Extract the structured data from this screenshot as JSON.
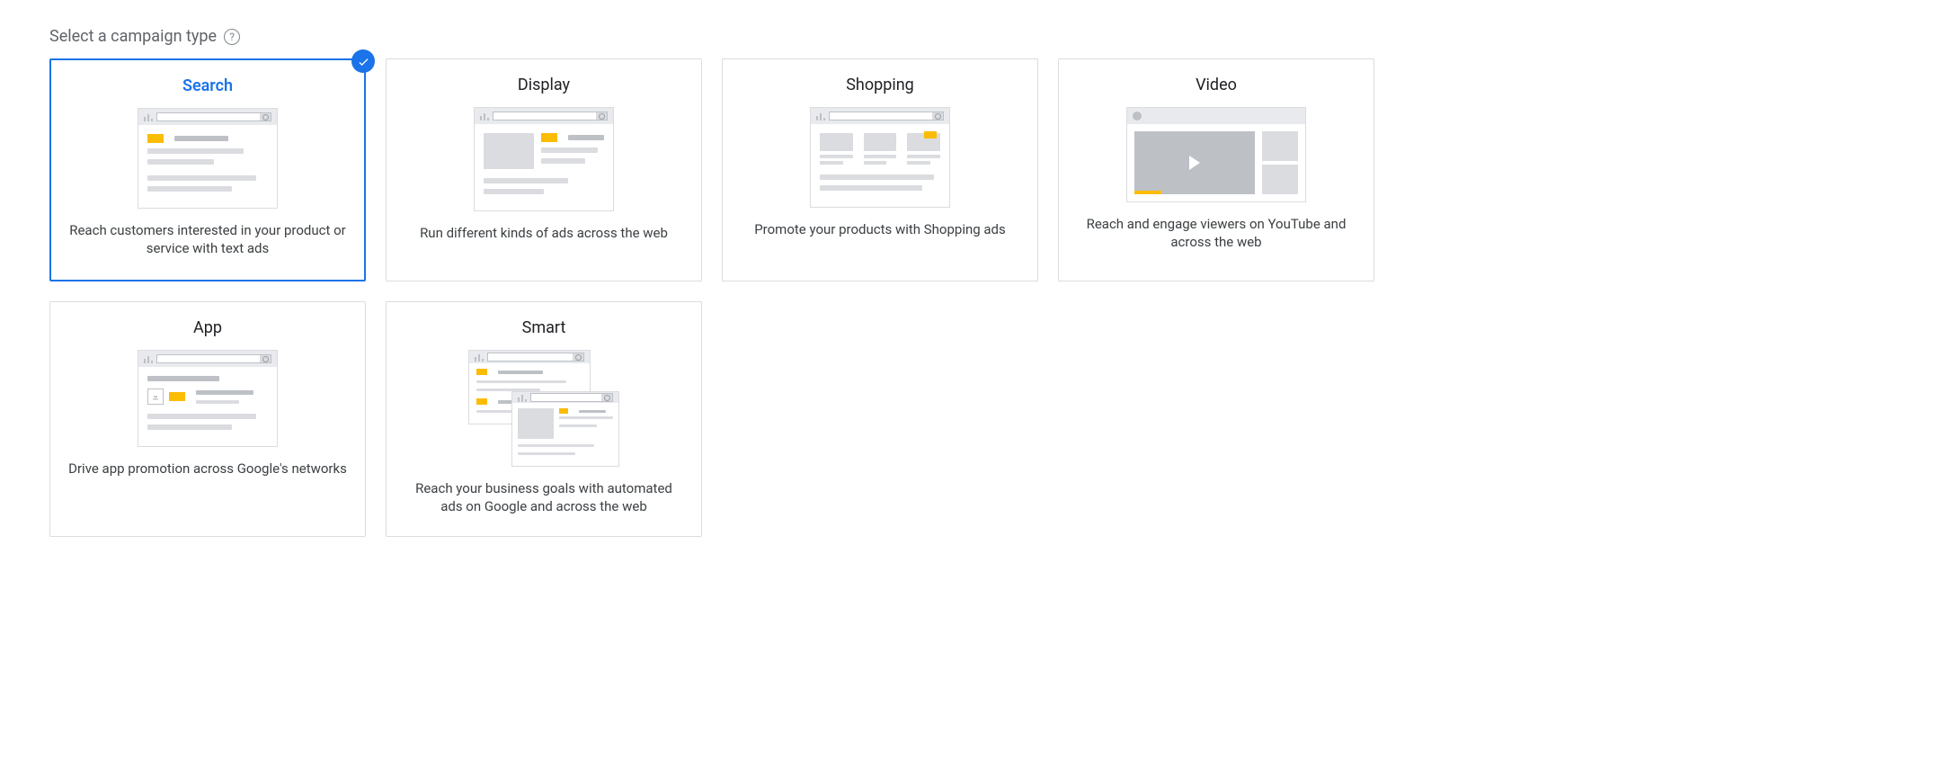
{
  "heading": "Select a campaign type",
  "cards": [
    {
      "id": "search",
      "title": "Search",
      "desc": "Reach customers interested in your product or service with text ads",
      "selected": true
    },
    {
      "id": "display",
      "title": "Display",
      "desc": "Run different kinds of ads across the web",
      "selected": false
    },
    {
      "id": "shopping",
      "title": "Shopping",
      "desc": "Promote your products with Shopping ads",
      "selected": false
    },
    {
      "id": "video",
      "title": "Video",
      "desc": "Reach and engage viewers on YouTube and across the web",
      "selected": false
    },
    {
      "id": "app",
      "title": "App",
      "desc": "Drive app promotion across Google's networks",
      "selected": false
    },
    {
      "id": "smart",
      "title": "Smart",
      "desc": "Reach your business goals with automated ads on Google and across the web",
      "selected": false
    }
  ]
}
